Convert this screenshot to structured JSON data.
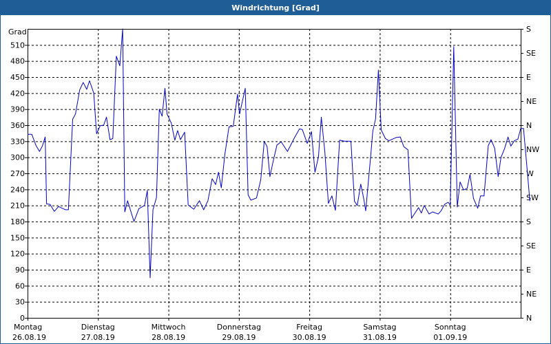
{
  "window": {
    "title": "Windrichtung [Grad]"
  },
  "colors": {
    "titlebar": "#1f5d96",
    "line": "#0000c8",
    "grid": "#000000",
    "background": "#ffffff"
  },
  "chart_data": {
    "type": "line",
    "title": "Windrichtung [Grad]",
    "ylabel": "Grad",
    "xlabel": "",
    "ylim": [
      0,
      540
    ],
    "xlim": [
      0,
      7
    ],
    "grid": true,
    "y_ticks": [
      0,
      30,
      60,
      90,
      120,
      150,
      180,
      210,
      240,
      270,
      300,
      330,
      360,
      390,
      420,
      450,
      480,
      510
    ],
    "y_tick_labels": [
      "0",
      "30",
      "60",
      "90",
      "120",
      "150",
      "180",
      "210",
      "240",
      "270",
      "300",
      "330",
      "360",
      "390",
      "420",
      "450",
      "480",
      "510"
    ],
    "right_ticks": [
      0,
      45,
      90,
      135,
      180,
      225,
      270,
      315,
      360,
      405,
      450,
      495,
      540
    ],
    "right_tick_labels": [
      "N",
      "NE",
      "E",
      "SE",
      "S",
      "SW",
      "W",
      "NW",
      "N",
      "NE",
      "E",
      "SE",
      "S"
    ],
    "x_ticks": [
      {
        "day": "Montag",
        "date": "26.08.19",
        "x": 0
      },
      {
        "day": "Dienstag",
        "date": "27.08.19",
        "x": 1
      },
      {
        "day": "Mittwoch",
        "date": "28.08.19",
        "x": 2
      },
      {
        "day": "Donnerstag",
        "date": "29.08.19",
        "x": 3
      },
      {
        "day": "Freitag",
        "date": "30.08.19",
        "x": 4
      },
      {
        "day": "Samstag",
        "date": "31.08.19",
        "x": 5
      },
      {
        "day": "Sonntag",
        "date": "01.09.19",
        "x": 6
      }
    ],
    "series": [
      {
        "values": [
          [
            0.0,
            343
          ],
          [
            0.06,
            343
          ],
          [
            0.12,
            322
          ],
          [
            0.17,
            311
          ],
          [
            0.21,
            321
          ],
          [
            0.25,
            338
          ],
          [
            0.27,
            213
          ],
          [
            0.32,
            212
          ],
          [
            0.38,
            199
          ],
          [
            0.44,
            208
          ],
          [
            0.54,
            202
          ],
          [
            0.58,
            202
          ],
          [
            0.64,
            371
          ],
          [
            0.68,
            381
          ],
          [
            0.74,
            426
          ],
          [
            0.79,
            440
          ],
          [
            0.84,
            427
          ],
          [
            0.88,
            443
          ],
          [
            0.94,
            420
          ],
          [
            0.98,
            344
          ],
          [
            1.03,
            359
          ],
          [
            1.08,
            360
          ],
          [
            1.12,
            375
          ],
          [
            1.17,
            333
          ],
          [
            1.21,
            335
          ],
          [
            1.26,
            489
          ],
          [
            1.31,
            471
          ],
          [
            1.35,
            540
          ],
          [
            1.38,
            198
          ],
          [
            1.42,
            219
          ],
          [
            1.51,
            180
          ],
          [
            1.58,
            204
          ],
          [
            1.66,
            210
          ],
          [
            1.7,
            238
          ],
          [
            1.74,
            75
          ],
          [
            1.78,
            202
          ],
          [
            1.83,
            225
          ],
          [
            1.87,
            390
          ],
          [
            1.91,
            377
          ],
          [
            1.95,
            429
          ],
          [
            1.98,
            381
          ],
          [
            2.04,
            364
          ],
          [
            2.09,
            332
          ],
          [
            2.13,
            350
          ],
          [
            2.17,
            333
          ],
          [
            2.23,
            347
          ],
          [
            2.28,
            211
          ],
          [
            2.36,
            203
          ],
          [
            2.44,
            219
          ],
          [
            2.5,
            202
          ],
          [
            2.56,
            219
          ],
          [
            2.62,
            260
          ],
          [
            2.67,
            249
          ],
          [
            2.71,
            272
          ],
          [
            2.75,
            243
          ],
          [
            2.8,
            305
          ],
          [
            2.86,
            357
          ],
          [
            2.92,
            358
          ],
          [
            2.98,
            418
          ],
          [
            3.01,
            381
          ],
          [
            3.09,
            429
          ],
          [
            3.13,
            230
          ],
          [
            3.17,
            220
          ],
          [
            3.25,
            224
          ],
          [
            3.31,
            258
          ],
          [
            3.36,
            330
          ],
          [
            3.4,
            320
          ],
          [
            3.44,
            264
          ],
          [
            3.48,
            289
          ],
          [
            3.54,
            323
          ],
          [
            3.6,
            329
          ],
          [
            3.69,
            311
          ],
          [
            3.79,
            337
          ],
          [
            3.86,
            353
          ],
          [
            3.9,
            352
          ],
          [
            3.97,
            326
          ],
          [
            4.03,
            348
          ],
          [
            4.08,
            272
          ],
          [
            4.13,
            301
          ],
          [
            4.17,
            375
          ],
          [
            4.22,
            311
          ],
          [
            4.27,
            214
          ],
          [
            4.32,
            228
          ],
          [
            4.37,
            201
          ],
          [
            4.43,
            332
          ],
          [
            4.5,
            330
          ],
          [
            4.59,
            330
          ],
          [
            4.64,
            218
          ],
          [
            4.68,
            210
          ],
          [
            4.73,
            250
          ],
          [
            4.77,
            224
          ],
          [
            4.8,
            200
          ],
          [
            4.87,
            301
          ],
          [
            4.9,
            348
          ],
          [
            4.94,
            372
          ],
          [
            4.98,
            463
          ],
          [
            5.02,
            351
          ],
          [
            5.08,
            335
          ],
          [
            5.13,
            331
          ],
          [
            5.23,
            337
          ],
          [
            5.29,
            338
          ],
          [
            5.34,
            320
          ],
          [
            5.4,
            314
          ],
          [
            5.45,
            186
          ],
          [
            5.51,
            198
          ],
          [
            5.55,
            206
          ],
          [
            5.59,
            196
          ],
          [
            5.63,
            210
          ],
          [
            5.7,
            194
          ],
          [
            5.75,
            198
          ],
          [
            5.83,
            194
          ],
          [
            5.87,
            200
          ],
          [
            5.92,
            212
          ],
          [
            5.97,
            216
          ],
          [
            6.0,
            211
          ],
          [
            6.05,
            507
          ],
          [
            6.1,
            207
          ],
          [
            6.14,
            254
          ],
          [
            6.19,
            239
          ],
          [
            6.24,
            242
          ],
          [
            6.28,
            268
          ],
          [
            6.33,
            223
          ],
          [
            6.39,
            205
          ],
          [
            6.43,
            228
          ],
          [
            6.48,
            228
          ],
          [
            6.54,
            322
          ],
          [
            6.58,
            333
          ],
          [
            6.63,
            317
          ],
          [
            6.68,
            264
          ],
          [
            6.72,
            300
          ],
          [
            6.77,
            316
          ],
          [
            6.82,
            338
          ],
          [
            6.86,
            321
          ],
          [
            6.91,
            331
          ],
          [
            6.96,
            334
          ],
          [
            7.0,
            354
          ],
          [
            7.04,
            354
          ],
          [
            7.1,
            265
          ],
          [
            7.13,
            218
          ]
        ]
      }
    ]
  }
}
